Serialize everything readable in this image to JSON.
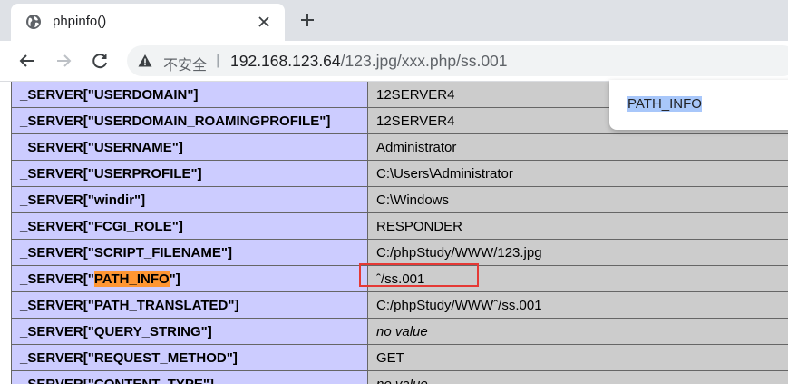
{
  "browser": {
    "tab_title": "phpinfo()",
    "security_label": "不安全",
    "url_host": "192.168.123.64",
    "url_path": "/123.jpg/xxx.php/ss.001"
  },
  "find_popup": {
    "text": "PATH_INFO"
  },
  "table": {
    "rows": [
      {
        "key": "_SERVER[\"USERDOMAIN\"]",
        "value": "12SERVER4"
      },
      {
        "key": "_SERVER[\"USERDOMAIN_ROAMINGPROFILE\"]",
        "value": "12SERVER4"
      },
      {
        "key": "_SERVER[\"USERNAME\"]",
        "value": "Administrator"
      },
      {
        "key": "_SERVER[\"USERPROFILE\"]",
        "value": "C:\\Users\\Administrator"
      },
      {
        "key": "_SERVER[\"windir\"]",
        "value": "C:\\Windows"
      },
      {
        "key": "_SERVER[\"FCGI_ROLE\"]",
        "value": "RESPONDER"
      },
      {
        "key": "_SERVER[\"SCRIPT_FILENAME\"]",
        "value": "C:/phpStudy/WWW/123.jpg"
      },
      {
        "key_prefix": "_SERVER[\"",
        "key_highlight": "PATH_INFO",
        "key_suffix": "\"]",
        "value": "ˆ/ss.001"
      },
      {
        "key": "_SERVER[\"PATH_TRANSLATED\"]",
        "value": "C:/phpStudy/WWWˆ/ss.001"
      },
      {
        "key": "_SERVER[\"QUERY_STRING\"]",
        "value": "no value"
      },
      {
        "key": "_SERVER[\"REQUEST_METHOD\"]",
        "value": "GET"
      },
      {
        "key": "_SERVER[\"CONTENT_TYPE\"]",
        "value": "no value"
      }
    ]
  }
}
